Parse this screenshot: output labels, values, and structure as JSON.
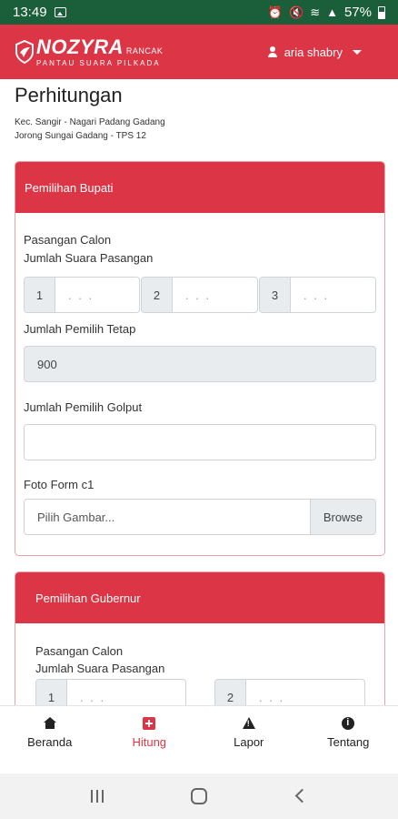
{
  "status_bar": {
    "time": "13:49",
    "battery": "57%",
    "icons": [
      "image-icon",
      "alarm-icon",
      "mute-icon",
      "wifi-icon",
      "signal-icon",
      "battery-icon"
    ]
  },
  "header": {
    "logo_main": "NOZYRA",
    "logo_sub": "RANCAK",
    "logo_tag": "PANTAU SUARA PILKADA",
    "user_name": "aria shabry"
  },
  "page": {
    "title": "Perhitungan",
    "location_line1": "Kec. Sangir - Nagari Padang Gadang",
    "location_line2": "Jorong Sungai Gadang - TPS 12"
  },
  "card_bupati": {
    "header": "Pemilihan Bupati",
    "label_pasangan": "Pasangan Calon",
    "label_jumlah_suara": "Jumlah Suara Pasangan",
    "candidates": [
      {
        "number": "1",
        "placeholder": ". . ."
      },
      {
        "number": "2",
        "placeholder": ". . ."
      },
      {
        "number": "3",
        "placeholder": ". . ."
      }
    ],
    "label_pemilih_tetap": "Jumlah Pemilih Tetap",
    "pemilih_tetap_value": "900",
    "label_golput": "Jumlah Pemilih Golput",
    "golput_value": "",
    "label_foto": "Foto Form c1",
    "file_placeholder": "Pilih Gambar...",
    "browse_label": "Browse"
  },
  "card_gubernur": {
    "header": "Pemilihan Gubernur",
    "label_pasangan": "Pasangan Calon",
    "label_jumlah_suara": "Jumlah Suara Pasangan",
    "candidates": [
      {
        "number": "1",
        "placeholder": ". . ."
      },
      {
        "number": "2",
        "placeholder": ". . ."
      }
    ]
  },
  "bottom_nav": {
    "items": [
      {
        "label": "Beranda",
        "icon": "home-icon",
        "active": false
      },
      {
        "label": "Hitung",
        "icon": "medkit-icon",
        "active": true
      },
      {
        "label": "Lapor",
        "icon": "warning-icon",
        "active": false
      },
      {
        "label": "Tentang",
        "icon": "info-icon",
        "active": false
      }
    ]
  },
  "colors": {
    "brand_red": "#dc3545",
    "status_bar_green": "#1b5e3a",
    "readonly_bg": "#e9ecef"
  }
}
